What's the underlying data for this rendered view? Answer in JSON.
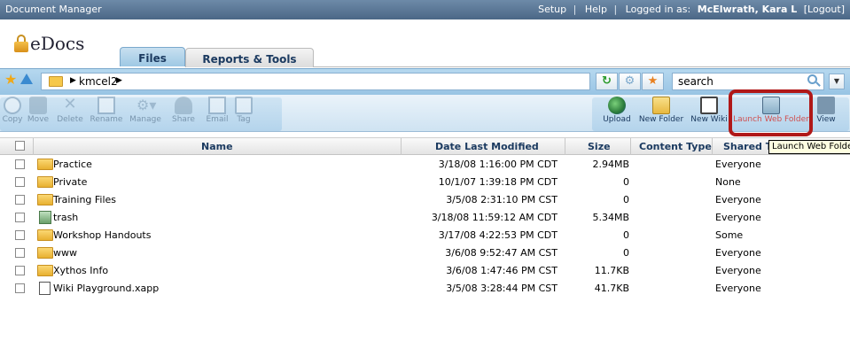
{
  "topbar": {
    "title": "Document Manager",
    "setup": "Setup",
    "sep": "|",
    "help": "Help",
    "logged_in_label": "Logged in as:",
    "user": "McElwrath, Kara L",
    "logout": "[Logout]"
  },
  "logo": {
    "text": "eDocs"
  },
  "tabs": [
    {
      "label": "Files",
      "active": true
    },
    {
      "label": "Reports & Tools",
      "active": false
    }
  ],
  "nav": {
    "path_arrow": "▶",
    "path": "kmcel2",
    "search_placeholder": "search",
    "search_value": "search"
  },
  "toolbar": {
    "left": [
      {
        "label": "Copy",
        "icon": "copy-icon"
      },
      {
        "label": "Move",
        "icon": "move-icon"
      },
      {
        "label": "Delete",
        "icon": "delete-icon"
      },
      {
        "label": "Rename",
        "icon": "rename-icon"
      },
      {
        "label": "Manage",
        "icon": "manage-icon"
      },
      {
        "label": "Share",
        "icon": "share-icon"
      },
      {
        "label": "Email",
        "icon": "email-icon"
      },
      {
        "label": "Tag",
        "icon": "tag-icon"
      }
    ],
    "right": [
      {
        "label": "Upload",
        "icon": "upload-icon"
      },
      {
        "label": "New Folder",
        "icon": "new-folder-icon"
      },
      {
        "label": "New Wiki",
        "icon": "new-wiki-icon"
      },
      {
        "label": "Launch Web Folder",
        "icon": "web-folder-icon"
      },
      {
        "label": "View",
        "icon": "view-icon"
      }
    ]
  },
  "tooltip": "Launch Web Folder",
  "table": {
    "headers": {
      "name": "Name",
      "date": "Date Last Modified",
      "size": "Size",
      "content_type": "Content Type",
      "shared": "Shared T"
    },
    "rows": [
      {
        "type": "folder",
        "name": "Practice",
        "date": "3/18/08 1:16:00 PM CDT",
        "size": "2.94MB",
        "shared": "Everyone"
      },
      {
        "type": "folder",
        "name": "Private",
        "date": "10/1/07 1:39:18 PM CDT",
        "size": "0",
        "shared": "None"
      },
      {
        "type": "folder",
        "name": "Training Files",
        "date": "3/5/08 2:31:10 PM CST",
        "size": "0",
        "shared": "Everyone"
      },
      {
        "type": "trash",
        "name": "trash",
        "date": "3/18/08 11:59:12 AM CDT",
        "size": "5.34MB",
        "shared": "Everyone"
      },
      {
        "type": "folder",
        "name": "Workshop Handouts",
        "date": "3/17/08 4:22:53 PM CDT",
        "size": "0",
        "shared": "Some"
      },
      {
        "type": "folder",
        "name": "www",
        "date": "3/6/08 9:52:47 AM CST",
        "size": "0",
        "shared": "Everyone"
      },
      {
        "type": "folder",
        "name": "Xythos Info",
        "date": "3/6/08 1:47:46 PM CST",
        "size": "11.7KB",
        "shared": "Everyone"
      },
      {
        "type": "file",
        "name": "Wiki Playground.xapp",
        "date": "3/5/08 3:28:44 PM CST",
        "size": "41.7KB",
        "shared": "Everyone"
      }
    ]
  }
}
